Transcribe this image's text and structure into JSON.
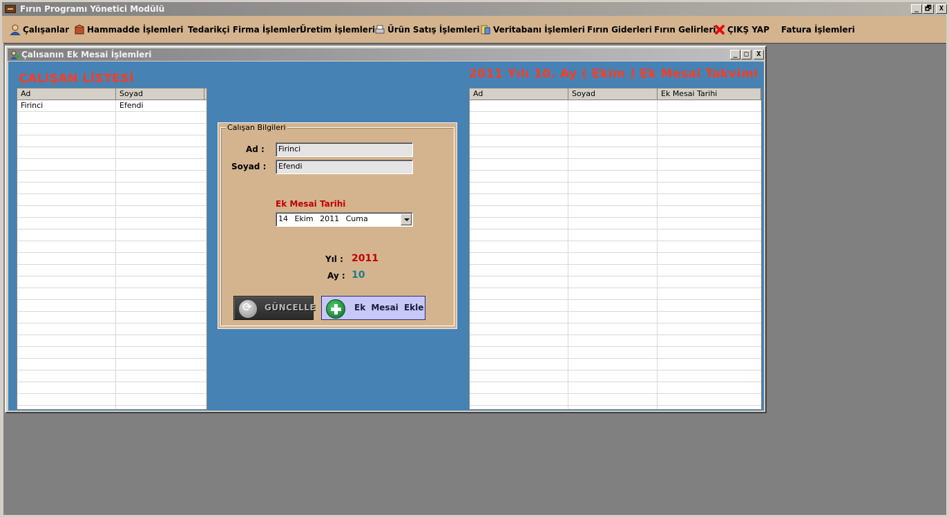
{
  "app": {
    "title": "Fırın Programı Yönetici Modülü",
    "window_buttons": [
      "_",
      "🗗",
      "X"
    ]
  },
  "menu": [
    {
      "label": "Çalışanlar",
      "icon": "user-icon"
    },
    {
      "label": "Hammadde  İşlemleri",
      "icon": "box-icon"
    },
    {
      "label": "Tedarikçi Firma İşlemleri",
      "icon": ""
    },
    {
      "label": "Üretim İşlemleri",
      "icon": ""
    },
    {
      "label": "Ürün Satış İşlemleri",
      "icon": "printer-icon"
    },
    {
      "label": "Veritabanı İşlemleri",
      "icon": "database-icon"
    },
    {
      "label": "Fırın Giderleri",
      "icon": ""
    },
    {
      "label": "Fırın Gelirleri",
      "icon": ""
    },
    {
      "label": "ÇIKŞ YAP",
      "icon": "exit-icon"
    },
    {
      "label": "Fatura İşlemleri",
      "icon": ""
    }
  ],
  "child_window": {
    "title": "Çalısanın Ek Mesai İşlemleri",
    "buttons": [
      "_",
      "□",
      "X"
    ]
  },
  "employee_list": {
    "heading": "ÇALIŞAN  LİSTESİ",
    "columns": [
      "Ad",
      "Soyad"
    ],
    "rows": [
      [
        "Firinci",
        "Efendi"
      ]
    ]
  },
  "overtime_list": {
    "heading": "2011 Yılı  10. Ay  ( Ekim ) Ek Mesai Takvimi",
    "columns": [
      "Ad",
      "Soyad",
      "Ek Mesai  Tarihi"
    ],
    "rows": []
  },
  "employee_info": {
    "group_label": "Calışan Bilgileri",
    "name_label": "Ad :",
    "name_value": "Firinci",
    "surname_label": "Soyad :",
    "surname_value": "Efendi",
    "date_label": "Ek Mesai Tarihi",
    "date_value": "14  Ekim  2011  Cuma",
    "year_label": "Yıl :",
    "year_value": "2011",
    "month_label": "Ay :",
    "month_value": "10",
    "update_button": "GÜNCELLE",
    "add_button": "Ek Mesai  Ekle"
  },
  "colors": {
    "menu_bg": "#d4b48f",
    "form_bg": "#4682b4",
    "heading_red": "#ff3b1f",
    "date_label_red": "#c00000",
    "month_teal": "#1f7a8c",
    "add_button_bg": "#c7c8f7"
  }
}
